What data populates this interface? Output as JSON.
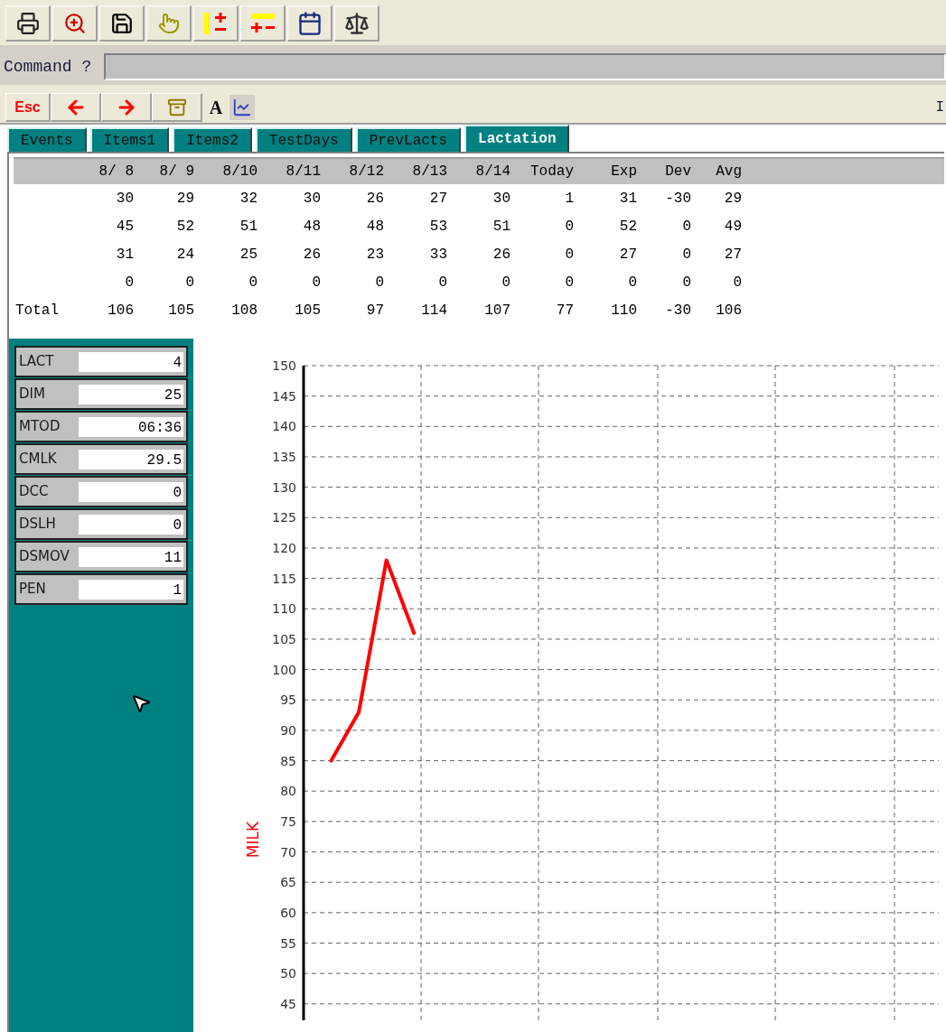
{
  "toolbar2": {
    "esc_label": "Esc",
    "font_label": "A",
    "right_text": "I"
  },
  "command": {
    "label": "Command ?"
  },
  "tabs": [
    {
      "label": "Events",
      "selected": false
    },
    {
      "label": "Items1",
      "selected": false
    },
    {
      "label": "Items2",
      "selected": false
    },
    {
      "label": "TestDays",
      "selected": false
    },
    {
      "label": "PrevLacts",
      "selected": false
    },
    {
      "label": "Lactation",
      "selected": true
    }
  ],
  "table": {
    "columns": [
      "",
      "8/ 8",
      "8/ 9",
      "8/10",
      "8/11",
      "8/12",
      "8/13",
      "8/14",
      "Today",
      "Exp",
      "Dev",
      "Avg"
    ],
    "rows": [
      [
        "",
        "30",
        "29",
        "32",
        "30",
        "26",
        "27",
        "30",
        "1",
        "31",
        "-30",
        "29"
      ],
      [
        "",
        "45",
        "52",
        "51",
        "48",
        "48",
        "53",
        "51",
        "0",
        "52",
        "0",
        "49"
      ],
      [
        "",
        "31",
        "24",
        "25",
        "26",
        "23",
        "33",
        "26",
        "0",
        "27",
        "0",
        "27"
      ],
      [
        "",
        "0",
        "0",
        "0",
        "0",
        "0",
        "0",
        "0",
        "0",
        "0",
        "0",
        "0"
      ],
      [
        "Total",
        "106",
        "105",
        "108",
        "105",
        "97",
        "114",
        "107",
        "77",
        "110",
        "-30",
        "106"
      ]
    ]
  },
  "fields": [
    {
      "label": "LACT",
      "value": "4"
    },
    {
      "label": "DIM",
      "value": "25"
    },
    {
      "label": "MTOD",
      "value": "06:36"
    },
    {
      "label": "CMLK",
      "value": "29.5"
    },
    {
      "label": "DCC",
      "value": "0"
    },
    {
      "label": "DSLH",
      "value": "0"
    },
    {
      "label": "DSMOV",
      "value": "11"
    },
    {
      "label": "PEN",
      "value": "1"
    }
  ],
  "chart": {
    "chart_data": {
      "type": "line",
      "ylabel": "MILK",
      "categories": [
        null,
        null,
        null,
        null,
        null,
        null,
        null,
        null,
        null,
        null,
        null,
        null,
        null,
        null,
        null,
        null,
        null,
        null,
        null,
        null,
        null,
        null,
        null,
        null
      ],
      "grid": true,
      "ylim": [
        42.3,
        150
      ],
      "yticks": [
        45,
        50,
        55,
        60,
        65,
        70,
        75,
        80,
        85,
        90,
        95,
        100,
        105,
        110,
        115,
        120,
        125,
        130,
        135,
        140,
        145,
        150
      ],
      "series": [
        {
          "color": "#ff0000",
          "values": [
            null,
            85,
            93,
            118,
            106,
            null,
            null,
            null,
            null,
            null,
            null,
            null,
            null,
            null,
            null,
            null,
            null,
            null,
            null,
            null,
            null,
            null,
            null,
            null
          ]
        }
      ]
    }
  }
}
